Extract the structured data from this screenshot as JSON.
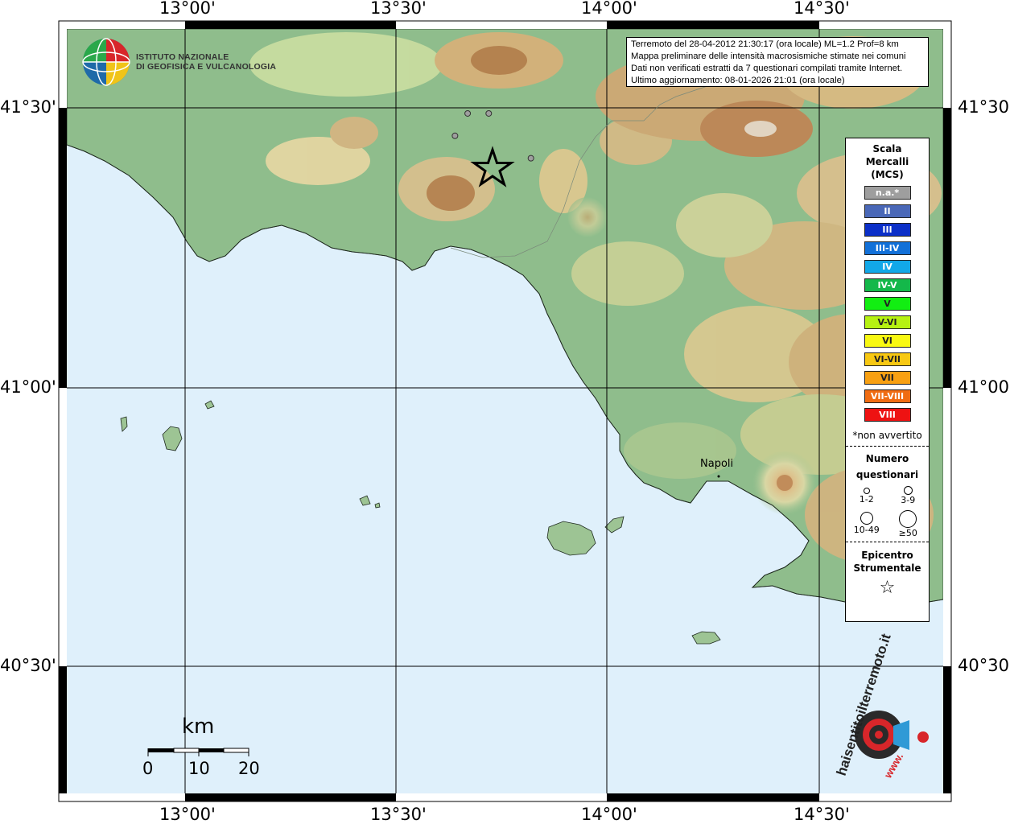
{
  "map": {
    "longitude_ticks": [
      "13°00'",
      "13°30'",
      "14°00'",
      "14°30'"
    ],
    "latitude_ticks": [
      "41°30'",
      "41°00'",
      "40°30'"
    ],
    "place_label": "Napoli",
    "colors": {
      "sea": "#dff0fb",
      "land": "#8fbd8c",
      "hills": "#e7d8a6",
      "mountains": "#c9955c"
    }
  },
  "header": {
    "org_line1": "ISTITUTO NAZIONALE",
    "org_line2": "DI GEOFISICA E VULCANOLOGIA"
  },
  "info": {
    "line1": "Terremoto del 28-04-2012 21:30:17 (ora locale) ML=1.2 Prof=8 km",
    "line2": "Mappa preliminare delle intensità macrosismiche stimate nei comuni",
    "line3": "Dati non verificati estratti da 7 questionari compilati tramite Internet.",
    "line4": "Ultimo aggiornamento: 08-01-2026 21:01 (ora locale)"
  },
  "legend": {
    "title_line1": "Scala",
    "title_line2": "Mercalli",
    "title_line3": "(MCS)",
    "items": [
      {
        "label": "n.a.*",
        "color": "#9e9e9e"
      },
      {
        "label": "II",
        "color": "#4a68b8"
      },
      {
        "label": "III",
        "color": "#0b2fc8"
      },
      {
        "label": "III-IV",
        "color": "#1270d8"
      },
      {
        "label": "IV",
        "color": "#12a8e8"
      },
      {
        "label": "IV-V",
        "color": "#14b84a"
      },
      {
        "label": "V",
        "color": "#12ee12"
      },
      {
        "label": "V-VI",
        "color": "#b6f212"
      },
      {
        "label": "VI",
        "color": "#f8f812"
      },
      {
        "label": "VI-VII",
        "color": "#f8c812"
      },
      {
        "label": "VII",
        "color": "#f8a012"
      },
      {
        "label": "VII-VIII",
        "color": "#f06c12"
      },
      {
        "label": "VIII",
        "color": "#ee1212"
      }
    ],
    "note": "*non avvertito",
    "num_title_line1": "Numero",
    "num_title_line2": "questionari",
    "num_classes": [
      "1-2",
      "3-9",
      "10-49",
      "≥50"
    ],
    "epi_line1": "Epicentro",
    "epi_line2": "Strumentale"
  },
  "scalebar": {
    "unit": "km",
    "labels": [
      "0",
      "10",
      "20"
    ]
  },
  "observations": [
    {
      "lon": 13.67,
      "lat": 41.49,
      "class": "1-2"
    },
    {
      "lon": 13.72,
      "lat": 41.49,
      "class": "1-2"
    },
    {
      "lon": 13.64,
      "lat": 41.45,
      "class": "1-2"
    },
    {
      "lon": 13.82,
      "lat": 41.41,
      "class": "1-2"
    }
  ],
  "epicenter": {
    "lon": 13.73,
    "lat": 41.4
  },
  "footer_logo": {
    "text": "haisentitoilterremoto.it",
    "prefix": "www."
  }
}
